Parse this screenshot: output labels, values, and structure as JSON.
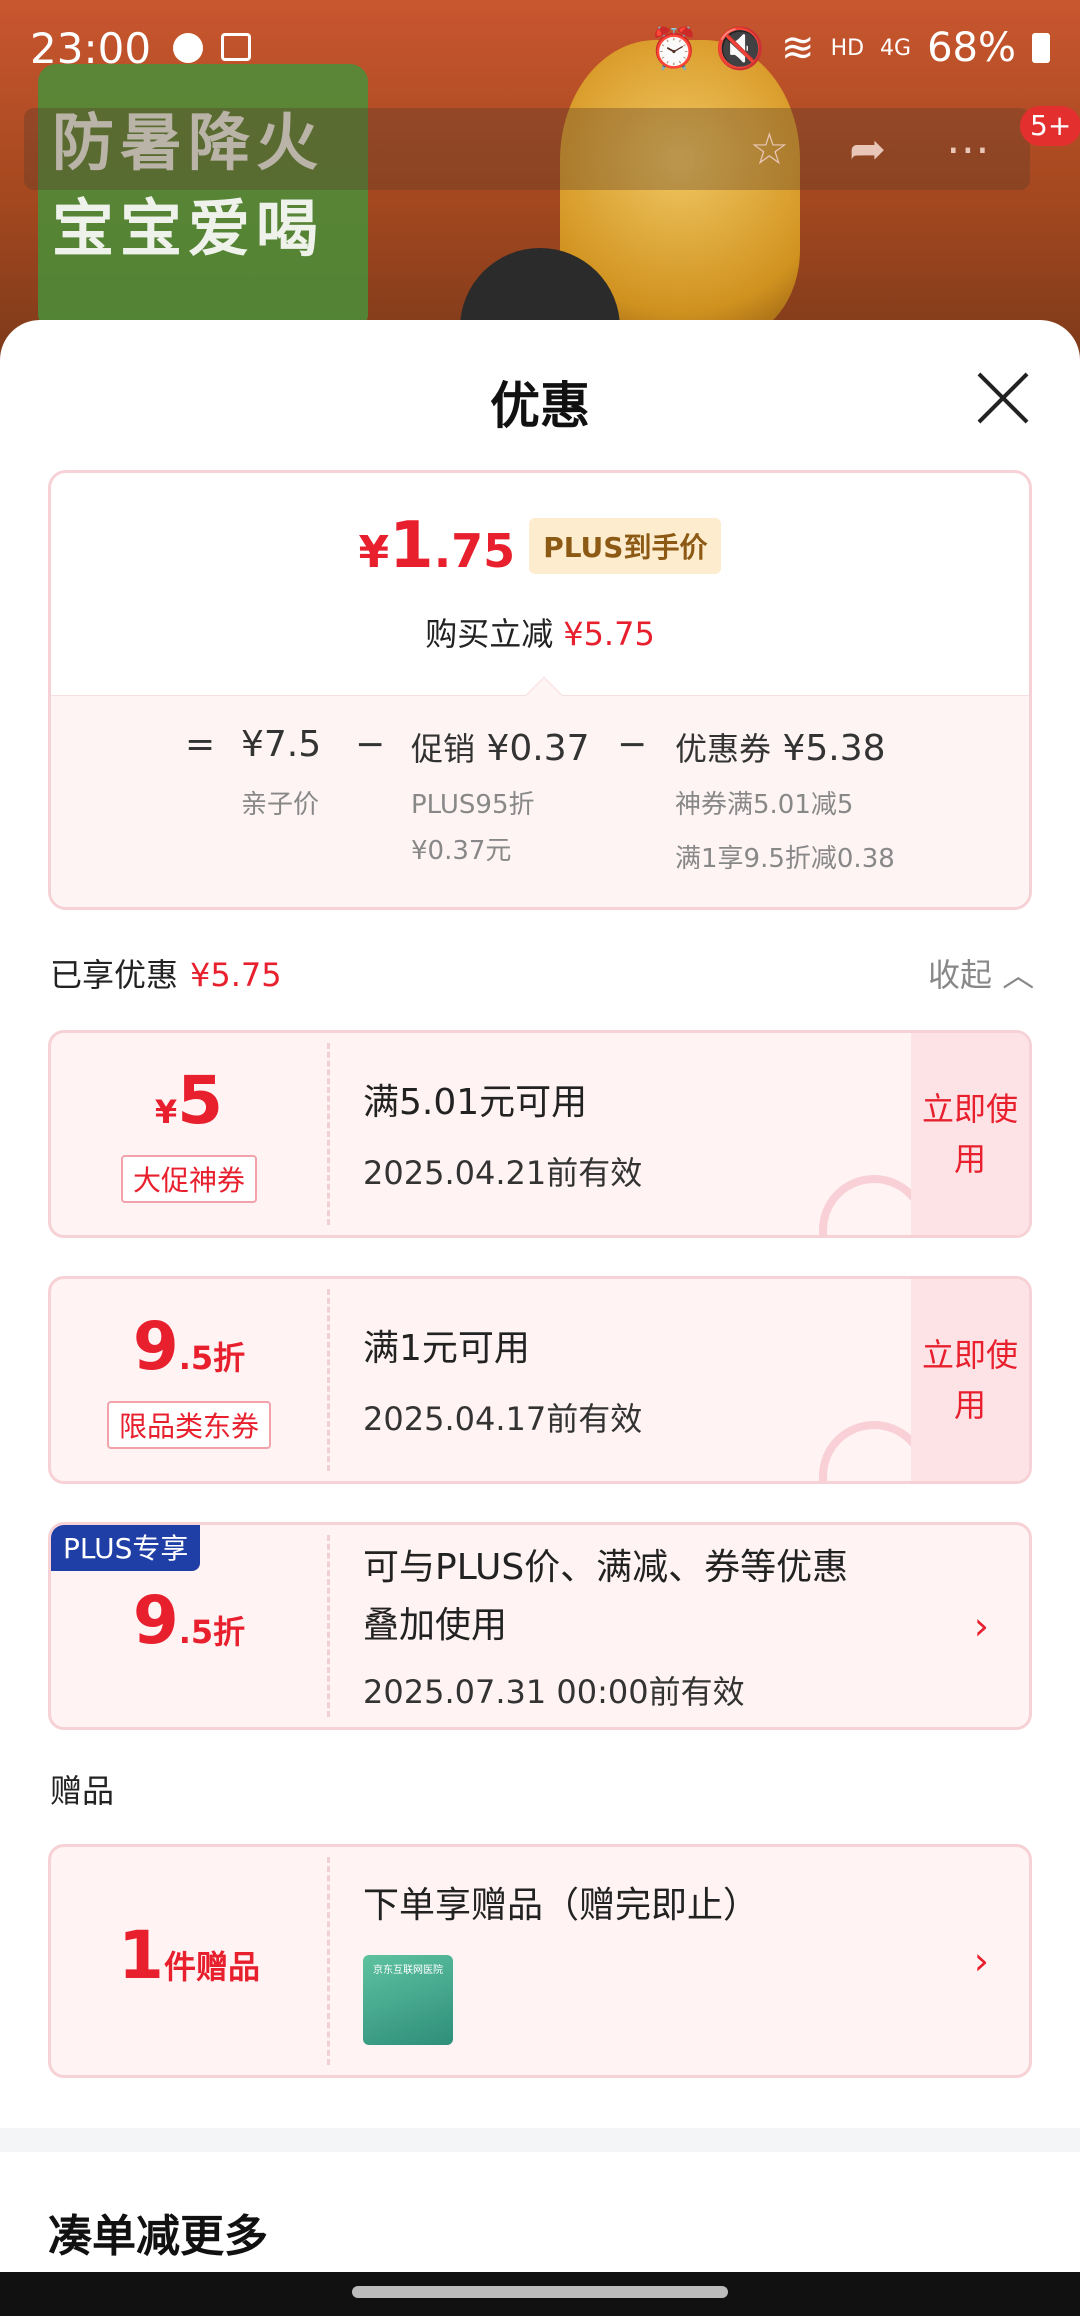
{
  "background": {
    "slogan_line1": "防暑降火",
    "slogan_line2": "宝宝爱喝",
    "cart_badge": "5+"
  },
  "status_bar": {
    "time": "23:00",
    "network": "HD",
    "signal_label": "4G",
    "battery": "68%"
  },
  "sheet": {
    "title": "优惠",
    "summary": {
      "currency": "¥",
      "price_int": "1",
      "price_dec": ".75",
      "plus_tag": "PLUS到手价",
      "reduce_label": "购买立减",
      "reduce_value": "¥5.75",
      "eq": "=",
      "base_price": "¥7.5",
      "base_label": "亲子价",
      "minus": "−",
      "promo_label": "促销",
      "promo_value": "¥0.37",
      "promo_desc1": "PLUS95折",
      "promo_desc2": "¥0.37元",
      "coupon_label": "优惠券",
      "coupon_value": "¥5.38",
      "coupon_desc1": "神券满5.01减5",
      "coupon_desc2": "满1享9.5折减0.38"
    },
    "enjoyed_label": "已享优惠",
    "enjoyed_value": "¥5.75",
    "collapse_label": "收起",
    "coupons": [
      {
        "prefix": "¥",
        "value": "5",
        "suffix": "",
        "tag": "大促神券",
        "line1": "满5.01元可用",
        "line2": "2025.04.21前有效",
        "action": "立即使用"
      },
      {
        "prefix": "",
        "value": "9",
        "suffix": ".5折",
        "tag": "限品类东券",
        "line1": "满1元可用",
        "line2": "2025.04.17前有效",
        "action": "立即使用"
      }
    ],
    "plus_card": {
      "corner": "PLUS专享",
      "value": "9",
      "suffix": ".5折",
      "line1": "可与PLUS价、满减、券等优惠",
      "line1b": "叠加使用",
      "line2": "2025.07.31 00:00前有效"
    },
    "gift_section": "赠品",
    "gift_card": {
      "value": "1",
      "suffix": "件赠品",
      "line1": "下单享赠品（赠完即止）",
      "img_label": "京东互联网医院"
    },
    "more_title": "凑单减更多"
  },
  "colors": {
    "accent": "#e8202e",
    "plus_blue": "#1f3fa6",
    "card_bg": "#fff3f3"
  }
}
